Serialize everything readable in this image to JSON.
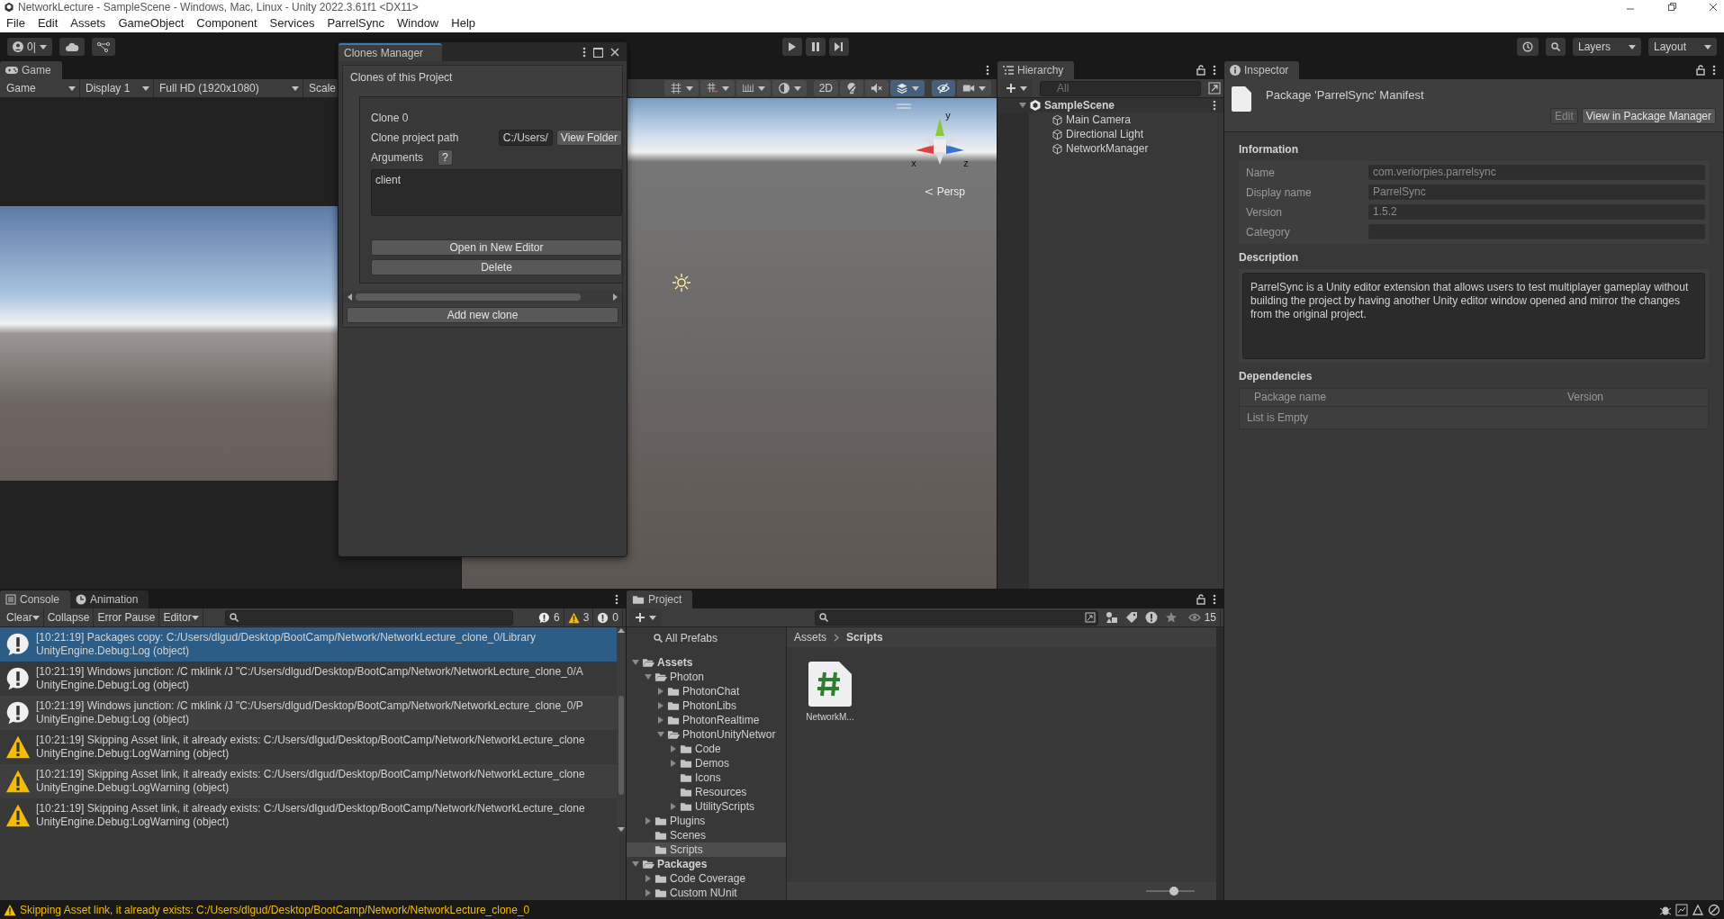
{
  "window": {
    "title": "NetworkLecture - SampleScene - Windows, Mac, Linux - Unity 2022.3.61f1 <DX11>"
  },
  "menu": [
    "File",
    "Edit",
    "Assets",
    "GameObject",
    "Component",
    "Services",
    "ParrelSync",
    "Window",
    "Help"
  ],
  "toolbar": {
    "account": "0|",
    "layers": "Layers",
    "layout": "Layout"
  },
  "game": {
    "tab": "Game",
    "dropdowns": [
      "Game",
      "Display 1",
      "Full HD (1920x1080)",
      "Scale"
    ]
  },
  "scene": {
    "tools": [
      {
        "kind": "grid",
        "on": false
      },
      {
        "kind": "snap",
        "on": false
      },
      {
        "kind": "ruler",
        "on": false
      },
      {
        "kind": "shading",
        "on": false
      },
      {
        "kind": "text",
        "label": "2D",
        "on": false
      },
      {
        "kind": "light",
        "on": false
      },
      {
        "kind": "audio",
        "on": false
      },
      {
        "kind": "effects",
        "on": true
      },
      {
        "kind": "visibility",
        "on": true
      },
      {
        "kind": "camera",
        "on": false
      }
    ],
    "gizmo_axes": [
      "y",
      "x",
      "z"
    ],
    "projection": "Persp"
  },
  "clones_manager": {
    "title": "Clones Manager",
    "heading": "Clones of this Project",
    "clones": [
      {
        "name": "Clone 0",
        "path_label": "Clone project path",
        "path": "C:/Users/",
        "view_button": "View Folder",
        "arguments_label": "Arguments",
        "help": "?",
        "arguments": "client",
        "open_button": "Open in New Editor",
        "delete_button": "Delete"
      }
    ],
    "add_button": "Add new clone"
  },
  "hierarchy": {
    "tab": "Hierarchy",
    "placeholder": "All",
    "scene": {
      "name": "SampleScene",
      "expanded": true,
      "selected": false,
      "children": [
        {
          "name": "Main Camera",
          "selected": false
        },
        {
          "name": "Directional Light",
          "selected": false
        },
        {
          "name": "NetworkManager",
          "selected": false
        }
      ]
    }
  },
  "inspector": {
    "tab": "Inspector",
    "title": "Package 'ParrelSync' Manifest",
    "buttons": [
      {
        "label": "Edit",
        "disabled": true
      },
      {
        "label": "View in Package Manager",
        "disabled": false
      }
    ],
    "information_heading": "Information",
    "fields": [
      {
        "label": "Name",
        "value": "com.veriorpies.parrelsync"
      },
      {
        "label": "Display name",
        "value": "ParrelSync"
      },
      {
        "label": "Version",
        "value": "1.5.2"
      },
      {
        "label": "Category"
      }
    ],
    "description_heading": "Description",
    "description": "ParrelSync is a Unity editor extension that allows users to test multiplayer gameplay without building the project by having another Unity editor window opened and mirror the changes from the original project.",
    "dependencies_heading": "Dependencies",
    "dependency_columns": [
      "Package name",
      "Version"
    ],
    "empty_text": "List is Empty"
  },
  "console": {
    "tabs": [
      {
        "label": "Console",
        "kind": "console",
        "selected": true
      },
      {
        "label": "Animation",
        "kind": "animation",
        "selected": false
      }
    ],
    "buttons": [
      "Clear",
      "Collapse",
      "Error Pause",
      "Editor"
    ],
    "counts": [
      {
        "kind": "info",
        "count": "6"
      },
      {
        "kind": "warning",
        "count": "3"
      },
      {
        "kind": "error",
        "count": "0"
      }
    ],
    "entries": [
      {
        "kind": "info",
        "selected": true,
        "message": "[10:21:19] Packages copy: C:/Users/dlgud/Desktop/BootCamp/Network/NetworkLecture_clone_0/Library",
        "source": "UnityEngine.Debug:Log (object)"
      },
      {
        "kind": "info",
        "selected": false,
        "message": "[10:21:19] Windows junction: /C mklink /J \"C:/Users/dlgud/Desktop/BootCamp/Network/NetworkLecture_clone_0/A",
        "source": "UnityEngine.Debug:Log (object)"
      },
      {
        "kind": "info",
        "selected": false,
        "message": "[10:21:19] Windows junction: /C mklink /J \"C:/Users/dlgud/Desktop/BootCamp/Network/NetworkLecture_clone_0/P",
        "source": "UnityEngine.Debug:Log (object)"
      },
      {
        "kind": "warning",
        "selected": false,
        "message": "[10:21:19] Skipping Asset link, it already exists: C:/Users/dlgud/Desktop/BootCamp/Network/NetworkLecture_clone",
        "source": "UnityEngine.Debug:LogWarning (object)"
      },
      {
        "kind": "warning",
        "selected": false,
        "message": "[10:21:19] Skipping Asset link, it already exists: C:/Users/dlgud/Desktop/BootCamp/Network/NetworkLecture_clone",
        "source": "UnityEngine.Debug:LogWarning (object)"
      },
      {
        "kind": "warning",
        "selected": false,
        "message": "[10:21:19] Skipping Asset link, it already exists: C:/Users/dlgud/Desktop/BootCamp/Network/NetworkLecture_clone",
        "source": "UnityEngine.Debug:LogWarning (object)"
      }
    ]
  },
  "project": {
    "tab": "Project",
    "hidden_count": "15",
    "tree": [
      {
        "name": "All Prefabs",
        "kind": "search",
        "selected": false
      },
      {
        "name": "Assets",
        "expanded": true,
        "selected": false,
        "children": [
          {
            "name": "Photon",
            "expanded": true,
            "selected": false,
            "children": [
              {
                "name": "PhotonChat",
                "expanded": false,
                "selected": false
              },
              {
                "name": "PhotonLibs",
                "expanded": false,
                "selected": false
              },
              {
                "name": "PhotonRealtime",
                "expanded": false,
                "selected": false
              },
              {
                "name": "PhotonUnityNetwor",
                "expanded": true,
                "selected": false,
                "children": [
                  {
                    "name": "Code",
                    "expanded": false,
                    "selected": false
                  },
                  {
                    "name": "Demos",
                    "expanded": false,
                    "selected": false
                  },
                  {
                    "name": "Icons",
                    "selected": false
                  },
                  {
                    "name": "Resources",
                    "selected": false
                  },
                  {
                    "name": "UtilityScripts",
                    "expanded": false,
                    "selected": false
                  }
                ]
              }
            ]
          },
          {
            "name": "Plugins",
            "expanded": false,
            "selected": false
          },
          {
            "name": "Scenes",
            "selected": false
          },
          {
            "name": "Scripts",
            "selected": true
          }
        ]
      },
      {
        "name": "Packages",
        "expanded": true,
        "selected": false,
        "children": [
          {
            "name": "Code Coverage",
            "expanded": false,
            "selected": false
          },
          {
            "name": "Custom NUnit",
            "expanded": false,
            "selected": false
          }
        ]
      }
    ],
    "breadcrumb": [
      "Assets",
      "Scripts"
    ],
    "files": [
      {
        "name": "NetworkM...",
        "kind": "script"
      }
    ],
    "zoom_slider": {
      "level": 0.58
    }
  },
  "status_bar": {
    "message": "Skipping Asset link, it already exists: C:/Users/dlgud/Desktop/BootCamp/Network/NetworkLecture_clone_0"
  }
}
